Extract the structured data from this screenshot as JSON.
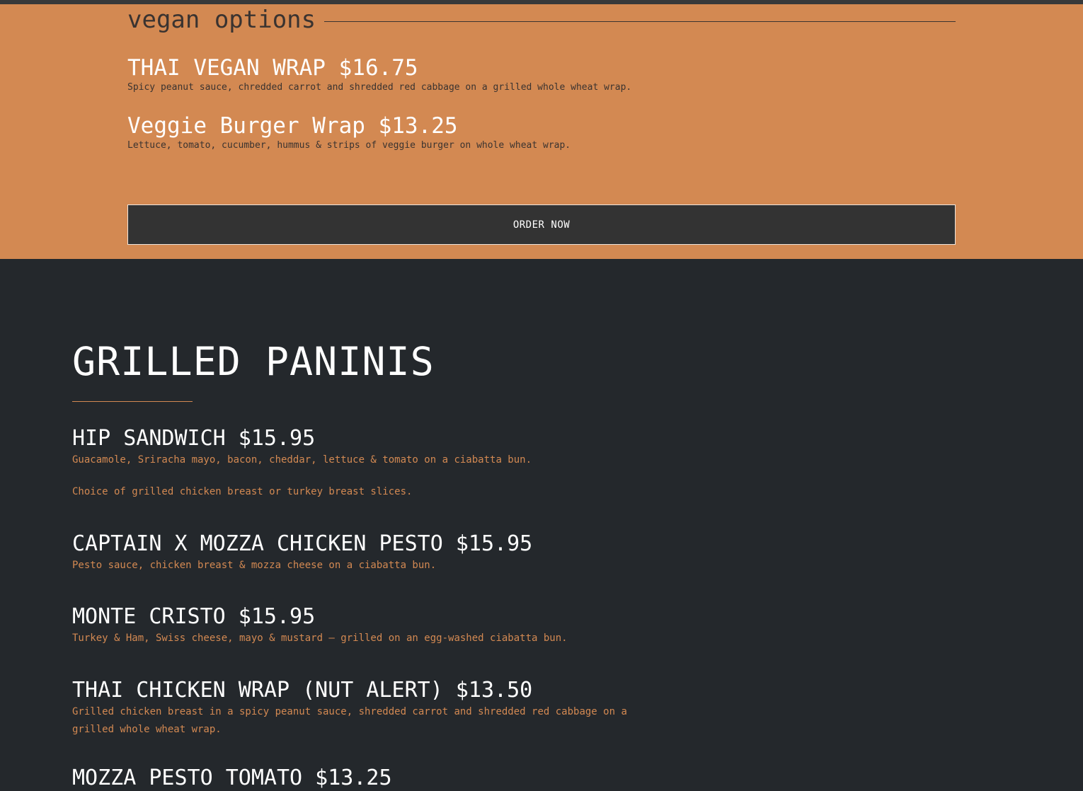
{
  "vegan": {
    "title": "vegan options",
    "items": [
      {
        "name": "THAI VEGAN WRAP $16.75",
        "desc": "Spicy peanut sauce, chredded carrot and shredded red cabbage on a grilled whole wheat wrap."
      },
      {
        "name": "Veggie Burger Wrap $13.25",
        "desc": "Lettuce, tomato, cucumber, hummus & strips of veggie burger on whole wheat wrap."
      }
    ],
    "order_label": "ORDER NOW"
  },
  "paninis": {
    "title": "GRILLED PANINIS",
    "items": [
      {
        "name": "HIP SANDWICH $15.95",
        "desc": "Guacamole, Sriracha mayo, bacon, cheddar, lettuce & tomato on a ciabatta bun.",
        "desc2": "Choice of grilled chicken breast or turkey breast slices."
      },
      {
        "name": "CAPTAIN X MOZZA CHICKEN PESTO  $15.95",
        "desc": "Pesto sauce, chicken breast & mozza cheese on a ciabatta bun."
      },
      {
        "name": "MONTE CRISTO $15.95",
        "desc": "Turkey & Ham, Swiss cheese, mayo & mustard – grilled on an egg-washed ciabatta bun."
      },
      {
        "name": "THAI CHICKEN WRAP (NUT ALERT) $13.50",
        "desc": "Grilled chicken breast in a spicy peanut sauce, shredded carrot and shredded red cabbage on a grilled whole wheat wrap."
      },
      {
        "name": "MOZZA PESTO TOMATO $13.25"
      }
    ]
  }
}
